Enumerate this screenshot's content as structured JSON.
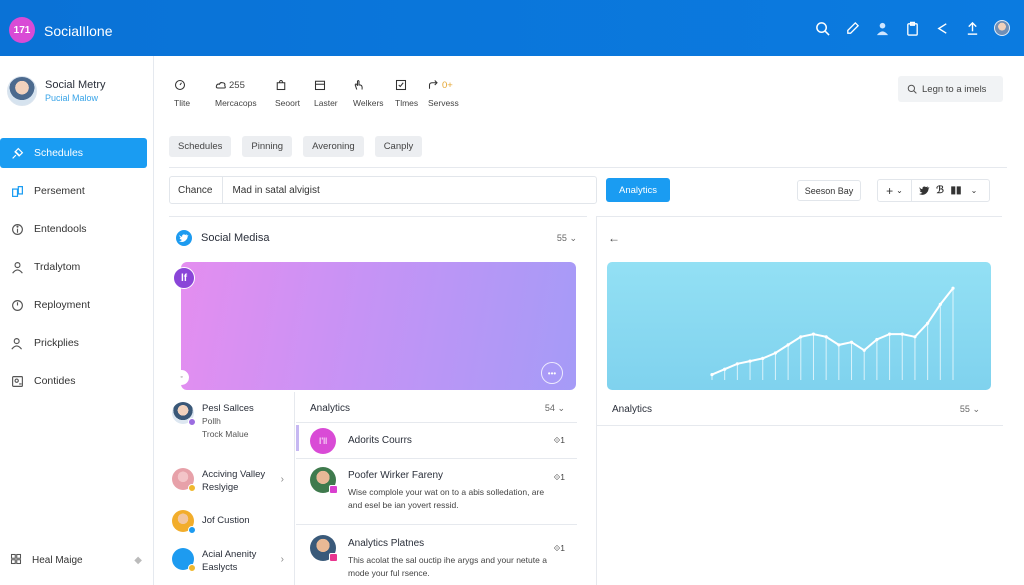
{
  "app": {
    "logo_text": "171",
    "title": "SocialIlone"
  },
  "topbar": {
    "icons": [
      "search-icon",
      "edit-icon",
      "user-icon",
      "clipboard-icon",
      "share-icon",
      "upload-icon",
      "avatar"
    ]
  },
  "profile": {
    "name": "Social Metry",
    "subtitle": "Pucial Malow"
  },
  "sidebar": {
    "items": [
      {
        "label": "Schedules",
        "icon": "pin-icon",
        "active": true
      },
      {
        "label": "Persement",
        "icon": "calendar-icon",
        "active": false
      },
      {
        "label": "Entendools",
        "icon": "info-icon",
        "active": false
      },
      {
        "label": "Trdalytom",
        "icon": "user-icon",
        "active": false
      },
      {
        "label": "Reployment",
        "icon": "timer-icon",
        "active": false
      },
      {
        "label": "Prickplies",
        "icon": "person-icon",
        "active": false
      },
      {
        "label": "Contides",
        "icon": "contacts-icon",
        "active": false
      }
    ],
    "footer_label": "Heal Maige"
  },
  "toolbar": {
    "tools": [
      {
        "label": "Tlite",
        "icon": "clock-icon",
        "value": ""
      },
      {
        "label": "Mercacops",
        "icon": "cloud-icon",
        "value": "255"
      },
      {
        "label": "Seoort",
        "icon": "bag-icon",
        "value": ""
      },
      {
        "label": "Laster",
        "icon": "calendar-icon",
        "value": ""
      },
      {
        "label": "Welkers",
        "icon": "hand-icon",
        "value": ""
      },
      {
        "label": "Tlmes",
        "icon": "check-icon",
        "value": ""
      },
      {
        "label": "Servess",
        "icon": "share-icon",
        "value": "0+"
      }
    ],
    "login_placeholder": "Legn to a imels"
  },
  "chips": [
    "Schedules",
    "Pinning",
    "Averoning",
    "Canply"
  ],
  "filter": {
    "label": "Chance",
    "value": "Mad in satal alvigist"
  },
  "buttons": {
    "analytics": "Analytics",
    "season": "Seeson Bay"
  },
  "social_tools": {
    "plus": "+",
    "chevron": "⌄"
  },
  "left_card": {
    "title": "Social Medisa",
    "count": "55",
    "hero_badge": "lf"
  },
  "sub_list": [
    {
      "line1": "Pesl Sallces",
      "line2": "Pollh",
      "line3": "Trock Malue"
    },
    {
      "line1": "Acciving Valley",
      "line2": "Reslyige"
    },
    {
      "line1": "Jof Custion",
      "line2": ""
    },
    {
      "line1": "Acial Anenity",
      "line2": "Easlycts"
    }
  ],
  "mid_list": {
    "title": "Analytics",
    "count": "54",
    "rows": [
      {
        "avatar": "I'll",
        "title": "Adorits Courrs",
        "desc": "",
        "meta": "1"
      },
      {
        "title": "Poofer Wirker Fareny",
        "desc": "Wise complole your wat on to a abis solledation, are and esel be ian yovert ressid.",
        "meta": "1"
      },
      {
        "title": "Analytics Platnes",
        "desc": "This acolat the sal ouctip ihe arygs and your netute a mode your ful rsence.",
        "meta": "1"
      }
    ]
  },
  "right_card": {
    "label": "Analytics",
    "count": "55"
  },
  "chart_data": {
    "type": "line",
    "x": [
      1,
      2,
      3,
      4,
      5,
      6,
      7,
      8,
      9,
      10,
      11,
      12,
      13,
      14,
      15,
      16,
      17,
      18,
      19,
      20
    ],
    "values": [
      2,
      4,
      6,
      7,
      8,
      10,
      13,
      16,
      17,
      16,
      13,
      14,
      11,
      15,
      17,
      17,
      16,
      21,
      28,
      34
    ],
    "title": "",
    "xlabel": "",
    "ylabel": "",
    "ylim": [
      0,
      40
    ],
    "grid": false
  }
}
